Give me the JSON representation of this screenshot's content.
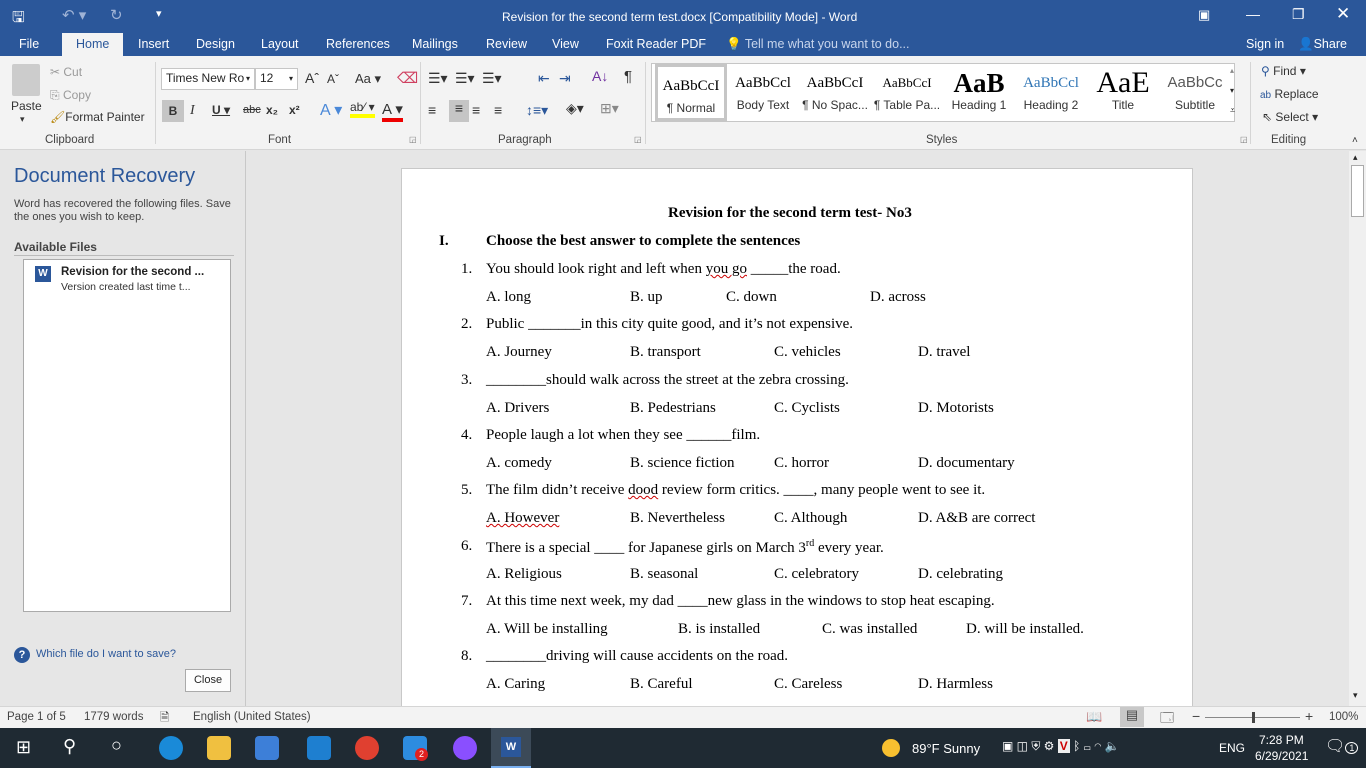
{
  "window": {
    "title": "Revision for the second term test.docx [Compatibility Mode] - Word"
  },
  "tabs": [
    "File",
    "Home",
    "Insert",
    "Design",
    "Layout",
    "References",
    "Mailings",
    "Review",
    "View",
    "Foxit Reader PDF"
  ],
  "tell_me": "Tell me what you want to do...",
  "sign_in": "Sign in",
  "share": "Share",
  "clipboard": {
    "paste": "Paste",
    "cut": "Cut",
    "copy": "Copy",
    "format_painter": "Format Painter",
    "group": "Clipboard"
  },
  "font": {
    "name": "Times New Ro",
    "size": "12",
    "group": "Font",
    "change_case": "Aa"
  },
  "paragraph": {
    "group": "Paragraph"
  },
  "styles": {
    "group": "Styles",
    "items": [
      {
        "preview": "AaBbCcI",
        "name": "¶ Normal"
      },
      {
        "preview": "AaBbCcl",
        "name": "Body Text"
      },
      {
        "preview": "AaBbCcI",
        "name": "¶ No Spac..."
      },
      {
        "preview": "AaBbCcI",
        "name": "¶ Table Pa..."
      },
      {
        "preview": "AaB",
        "name": "Heading 1"
      },
      {
        "preview": "AaBbCcl",
        "name": "Heading 2"
      },
      {
        "preview": "AaE",
        "name": "Title"
      },
      {
        "preview": "AaBbCc",
        "name": "Subtitle"
      }
    ]
  },
  "editing": {
    "group": "Editing",
    "find": "Find",
    "replace": "Replace",
    "select": "Select"
  },
  "recovery": {
    "title": "Document Recovery",
    "desc": "Word has recovered the following files. Save the ones you wish to keep.",
    "available": "Available Files",
    "file_name": "Revision for the second ...",
    "file_desc": "Version created last time t...",
    "help": "Which file do I want to save?",
    "close": "Close"
  },
  "document": {
    "title": "Revision for the second term test- No3",
    "section_num": "I.",
    "section_title": "Choose the best answer to complete the sentences",
    "questions": [
      {
        "n": "1.",
        "pre": "You should look right and left when ",
        "sq": "you  go",
        "post": " _____the road.",
        "opts": [
          "A.  long",
          "B. up",
          "C. down",
          "D. across"
        ]
      },
      {
        "n": "2.",
        "pre": "Public _______in this city quite good, and it’s not expensive.",
        "opts": [
          "A.  Journey",
          "B. transport",
          "C. vehicles",
          "D. travel"
        ]
      },
      {
        "n": "3.",
        "pre": "________should walk across the street at the zebra crossing.",
        "opts": [
          "A.  Drivers",
          "B. Pedestrians",
          "C. Cyclists",
          "D. Motorists"
        ]
      },
      {
        "n": "4.",
        "pre": "People laugh a lot when they see ______film.",
        "opts": [
          "A.  comedy",
          "B. science fiction",
          "C. horror",
          "D. documentary"
        ]
      },
      {
        "n": "5.",
        "pre": "The film didn’t receive ",
        "sq": "dood",
        "post": " review form critics. ____, many people went to see it.",
        "opts": [
          "A.  However",
          "B. Nevertheless",
          "C. Although",
          "D. A&B are correct"
        ]
      },
      {
        "n": "6.",
        "pre": "There is a special ____ for Japanese girls on March 3",
        "sup": "rd",
        "post": " every year.",
        "opts": [
          "A.  Religious",
          "B. seasonal",
          "C. celebratory",
          "D. celebrating"
        ]
      },
      {
        "n": "7.",
        "pre": "At this time next week, my dad ____new glass in the windows to stop heat escaping.",
        "opts": [
          "A.  Will be installing",
          "B. is installed",
          "C. was installed",
          "D. will be installed."
        ]
      },
      {
        "n": "8.",
        "pre": "________driving will cause accidents on the road.",
        "opts": [
          "A.  Caring",
          "B. Careful",
          "C. Careless",
          "D. Harmless"
        ]
      }
    ]
  },
  "status": {
    "page": "Page 1 of 5",
    "words": "1779 words",
    "language": "English (United States)",
    "zoom": "100%",
    "zoom_level": 100
  },
  "taskbar": {
    "weather": "89°F  Sunny",
    "lang": "ENG",
    "time": "7:28 PM",
    "date": "6/29/2021",
    "notifications": "1",
    "zalo_badge": "2"
  }
}
